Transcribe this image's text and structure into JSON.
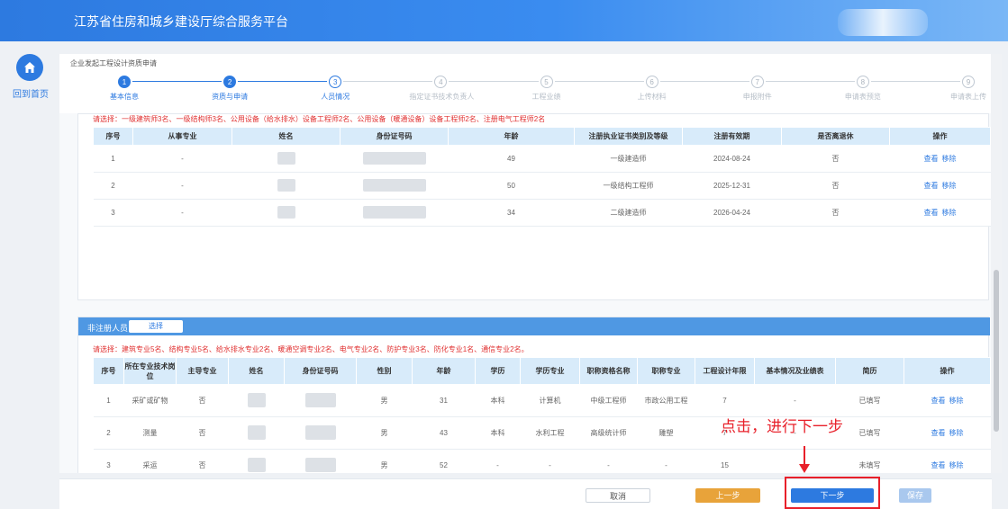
{
  "header": {
    "title": "江苏省住房和城乡建设厅综合服务平台"
  },
  "sidebar": {
    "home_label": "回到首页"
  },
  "breadcrumb": "企业发起工程设计资质申请",
  "steps": [
    {
      "num": "1",
      "label": "基本信息",
      "state": "done"
    },
    {
      "num": "2",
      "label": "资质与申请",
      "state": "done"
    },
    {
      "num": "3",
      "label": "人员情况",
      "state": "current"
    },
    {
      "num": "4",
      "label": "指定证书技术负责人",
      "state": "todo"
    },
    {
      "num": "5",
      "label": "工程业绩",
      "state": "todo"
    },
    {
      "num": "6",
      "label": "上传材料",
      "state": "todo"
    },
    {
      "num": "7",
      "label": "申报附件",
      "state": "todo"
    },
    {
      "num": "8",
      "label": "申请表预览",
      "state": "todo"
    },
    {
      "num": "9",
      "label": "申请表上传",
      "state": "todo"
    }
  ],
  "registered": {
    "hint": "请选择：一级建筑师3名、一级结构师3名、公用设备（给水排水）设备工程师2名、公用设备（暖通设备）设备工程师2名、注册电气工程师2名",
    "headers": [
      "序号",
      "从事专业",
      "姓名",
      "身份证号码",
      "年龄",
      "注册执业证书类别及等级",
      "注册有效期",
      "是否离退休",
      "操作"
    ],
    "rows": [
      {
        "no": "1",
        "major": "-",
        "age": "49",
        "cert": "一级建造师",
        "valid": "2024-08-24",
        "retired": "否"
      },
      {
        "no": "2",
        "major": "-",
        "age": "50",
        "cert": "一级结构工程师",
        "valid": "2025-12-31",
        "retired": "否"
      },
      {
        "no": "3",
        "major": "-",
        "age": "34",
        "cert": "二级建造师",
        "valid": "2026-04-24",
        "retired": "否"
      }
    ],
    "op_view": "查看",
    "op_remove": "移除"
  },
  "unregistered": {
    "title": "非注册人员",
    "select_label": "选择",
    "hint": "请选择：建筑专业5名、结构专业5名、给水排水专业2名、暖通空调专业2名、电气专业2名、防护专业3名、防化专业1名、通信专业2名。",
    "headers": [
      "序号",
      "所在专业技术岗位",
      "主导专业",
      "姓名",
      "身份证号码",
      "性别",
      "年龄",
      "学历",
      "学历专业",
      "职称资格名称",
      "职称专业",
      "工程设计年限",
      "基本情况及业绩表",
      "简历",
      "操作"
    ],
    "rows": [
      {
        "no": "1",
        "post": "采矿或矿物",
        "lead": "否",
        "gender": "男",
        "age": "31",
        "edu": "本科",
        "edu_major": "计算机",
        "title": "中级工程师",
        "title_major": "市政公用工程",
        "years": "7",
        "basic": "-",
        "resume": "已填写"
      },
      {
        "no": "2",
        "post": "测量",
        "lead": "否",
        "gender": "男",
        "age": "43",
        "edu": "本科",
        "edu_major": "水利工程",
        "title": "高级统计师",
        "title_major": "雕塑",
        "years": "7",
        "basic": "-",
        "resume": "已填写"
      },
      {
        "no": "3",
        "post": "采运",
        "lead": "否",
        "gender": "男",
        "age": "52",
        "edu": "-",
        "edu_major": "-",
        "title": "-",
        "title_major": "-",
        "years": "15",
        "basic": "",
        "resume": "未填写"
      }
    ],
    "op_view": "查看",
    "op_remove": "移除"
  },
  "footer": {
    "cancel": "取消",
    "prev": "上一步",
    "next": "下一步",
    "save": "保存"
  },
  "annotation": "点击，进行下一步",
  "colors": {
    "primary": "#2d7ae0",
    "warning": "#e8a33a",
    "annotation": "#e8202a"
  }
}
